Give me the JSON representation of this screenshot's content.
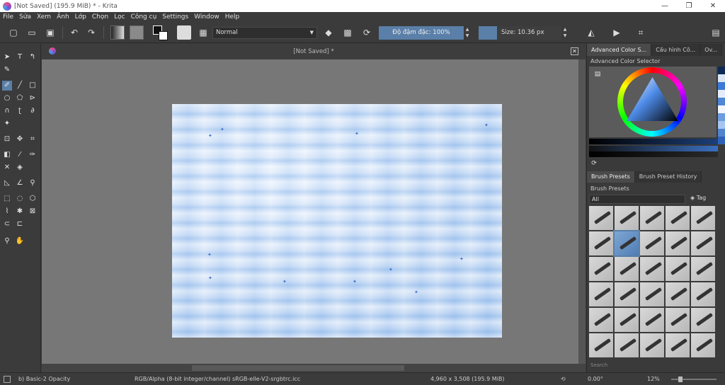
{
  "window": {
    "title": "[Not Saved]  (195.9 MiB)  * - Krita",
    "minimize": "—",
    "restore": "❐",
    "close": "✕"
  },
  "menu": [
    "File",
    "Sửa",
    "Xem",
    "Ảnh",
    "Lớp",
    "Chọn",
    "Lọc",
    "Công cụ",
    "Settings",
    "Window",
    "Help"
  ],
  "toolbar": {
    "blend_mode": "Normal",
    "opacity": "Độ đậm đặc: 100%",
    "size": "Size: 10.36 px",
    "accent_color": "#5a7fa8"
  },
  "document": {
    "tab_title": "[Not Saved]  *"
  },
  "dock": {
    "tabs": [
      "Advanced Color S...",
      "Cấu hình Cô...",
      "Ov..."
    ],
    "color_selector_label": "Advanced Color Selector",
    "preset_tabs": [
      "Brush Presets",
      "Brush Preset History"
    ],
    "presets_label": "Brush Presets",
    "filter_value": "All",
    "tag_label": "Tag",
    "search_placeholder": "Search"
  },
  "status": {
    "brush": "b) Basic-2 Opacity",
    "color_space": "RGB/Alpha (8-bit integer/channel)  sRGB-elle-V2-srgbtrc.icc",
    "dimensions": "4,960 x 3,508 (195.9 MiB)",
    "rotation": "0.00°",
    "zoom": "12%"
  }
}
